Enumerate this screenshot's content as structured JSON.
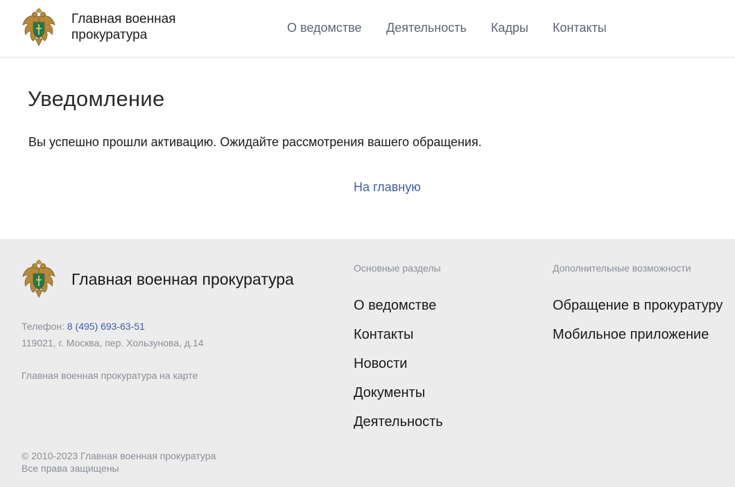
{
  "header": {
    "site_name": "Главная военная прокуратура",
    "nav": [
      "О ведомстве",
      "Деятельность",
      "Кадры",
      "Контакты"
    ]
  },
  "main": {
    "title": "Уведомление",
    "message": "Вы успешно прошли активацию. Ожидайте рассмотрения вашего обращения.",
    "home_link": "На главную"
  },
  "footer": {
    "site_name": "Главная военная прокуратура",
    "phone_label": "Телефон:",
    "phone": "8 (495) 693-63-51",
    "address": "119021, г. Москва, пер. Хользунова, д.14",
    "map_link": "Главная военная прокуратура на карте",
    "sections_title": "Основные разделы",
    "sections": [
      "О ведомстве",
      "Контакты",
      "Новости",
      "Документы",
      "Деятельность"
    ],
    "extra_title": "Дополнительные возможности",
    "extra": [
      "Обращение в прокуратуру",
      "Мобильное приложение"
    ],
    "copyright": "© 2010-2023 Главная военная прокуратура",
    "rights": "Все права защищены"
  },
  "colors": {
    "link": "#3f5ea8",
    "footer_bg": "#ececec",
    "muted_text": "#8a8f99",
    "emblem_gold": "#b5893b",
    "emblem_green": "#1f7a4a"
  },
  "icons": {
    "emblem": "prosecutor-emblem-icon"
  }
}
